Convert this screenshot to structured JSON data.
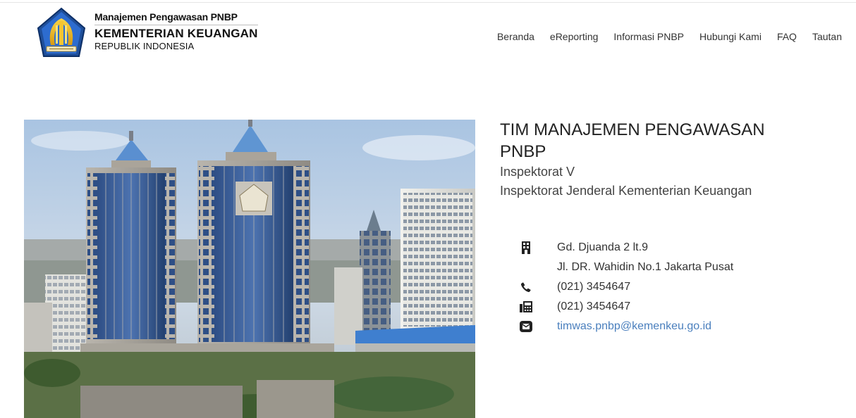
{
  "header": {
    "brand_line1": "Manajemen Pengawasan PNBP",
    "brand_line2": "KEMENTERIAN KEUANGAN",
    "brand_line3": "REPUBLIK INDONESIA",
    "logo_icon": "kemenkeu-logo",
    "nav": [
      {
        "label": "Beranda"
      },
      {
        "label": "eReporting"
      },
      {
        "label": "Informasi PNBP"
      },
      {
        "label": "Hubungi Kami"
      },
      {
        "label": "FAQ"
      },
      {
        "label": "Tautan"
      }
    ]
  },
  "photo": {
    "icon": "building-photo"
  },
  "info": {
    "title": "TIM MANAJEMEN PENGAWASAN PNBP",
    "subtitle1": "Inspektorat V",
    "subtitle2": "Inspektorat Jenderal Kementerian Keuangan",
    "address_line1": "Gd. Djuanda 2 lt.9",
    "address_line2": "Jl. DR. Wahidin No.1 Jakarta Pusat",
    "phone": "(021) 3454647",
    "fax": "(021) 3454647",
    "email": "timwas.pnbp@kemenkeu.go.id",
    "icons": [
      "building-icon",
      "phone-icon",
      "fax-icon",
      "email-icon"
    ],
    "link_color": "#4a7fbd"
  }
}
